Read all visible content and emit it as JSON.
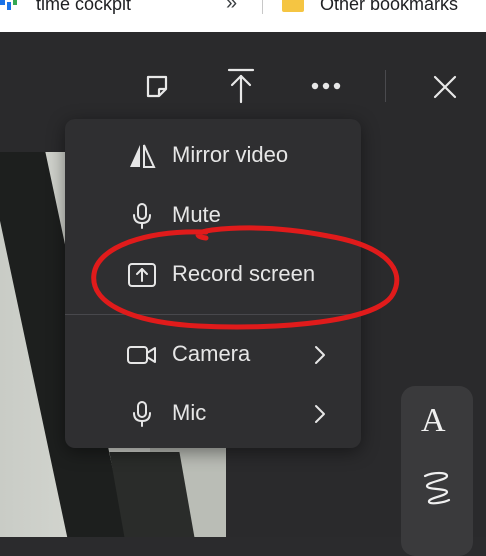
{
  "bookmarks_bar": {
    "item1_label": "time cockpit",
    "overflow_glyph": "»",
    "item2_label": "Other bookmarks"
  },
  "toolbar": {
    "sticky_note_icon": "sticky-note-icon",
    "share_icon": "share-upload-icon",
    "more_icon": "more-horizontal-icon",
    "close_icon": "close-icon"
  },
  "menu": {
    "items": [
      {
        "label": "Mirror video",
        "icon": "mirror-icon"
      },
      {
        "label": "Mute",
        "icon": "microphone-icon"
      },
      {
        "label": "Record screen",
        "icon": "record-screen-icon"
      },
      {
        "label": "Camera",
        "icon": "camera-icon",
        "has_submenu": true
      },
      {
        "label": "Mic",
        "icon": "microphone-icon",
        "has_submenu": true
      }
    ]
  },
  "palette": {
    "text_tool_label": "A",
    "draw_tool_icon": "scribble-icon"
  },
  "colors": {
    "background": "#2a2a2c",
    "menu_bg": "#2f2f31",
    "annotation_red": "#e01b1b",
    "text": "#e6e6e6"
  }
}
